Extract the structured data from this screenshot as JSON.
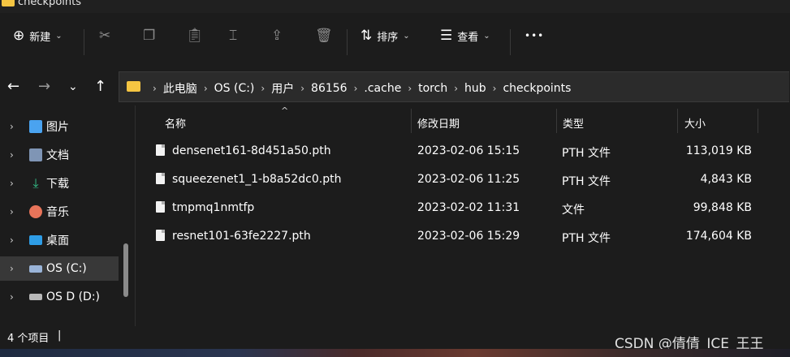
{
  "window": {
    "title": "checkpoints"
  },
  "toolbar": {
    "new_label": "新建",
    "sort_label": "排序",
    "view_label": "查看",
    "more_label": "•••"
  },
  "breadcrumb": [
    "此电脑",
    "OS (C:)",
    "用户",
    "86156",
    ".cache",
    "torch",
    "hub",
    "checkpoints"
  ],
  "sidebar": {
    "items": [
      {
        "label": "图片",
        "icon": "pictures-icon",
        "color": "#4aa3f0"
      },
      {
        "label": "文档",
        "icon": "documents-icon",
        "color": "#7f95b5"
      },
      {
        "label": "下载",
        "icon": "downloads-icon",
        "color": "#35c28a"
      },
      {
        "label": "音乐",
        "icon": "music-icon",
        "color": "#e8745a"
      },
      {
        "label": "桌面",
        "icon": "desktop-icon",
        "color": "#2e9de6"
      },
      {
        "label": "OS (C:)",
        "icon": "drive-c-icon",
        "color": "#9ab4d8"
      },
      {
        "label": "OS D (D:)",
        "icon": "drive-d-icon",
        "color": "#b8b8b8"
      }
    ]
  },
  "columns": {
    "name": "名称",
    "date": "修改日期",
    "type": "类型",
    "size": "大小"
  },
  "files": [
    {
      "name": "densenet161-8d451a50.pth",
      "date": "2023-02-06 15:15",
      "type": "PTH 文件",
      "size": "113,019 KB"
    },
    {
      "name": "squeezenet1_1-b8a52dc0.pth",
      "date": "2023-02-06 11:25",
      "type": "PTH 文件",
      "size": "4,843 KB"
    },
    {
      "name": "tmpmq1nmtfp",
      "date": "2023-02-02 11:31",
      "type": "文件",
      "size": "99,848 KB"
    },
    {
      "name": "resnet101-63fe2227.pth",
      "date": "2023-02-06 15:29",
      "type": "PTH 文件",
      "size": "174,604 KB"
    }
  ],
  "status": {
    "item_count": "4 个项目",
    "cursor": "|"
  },
  "watermark": "CSDN @倩倩_ICE_王王"
}
